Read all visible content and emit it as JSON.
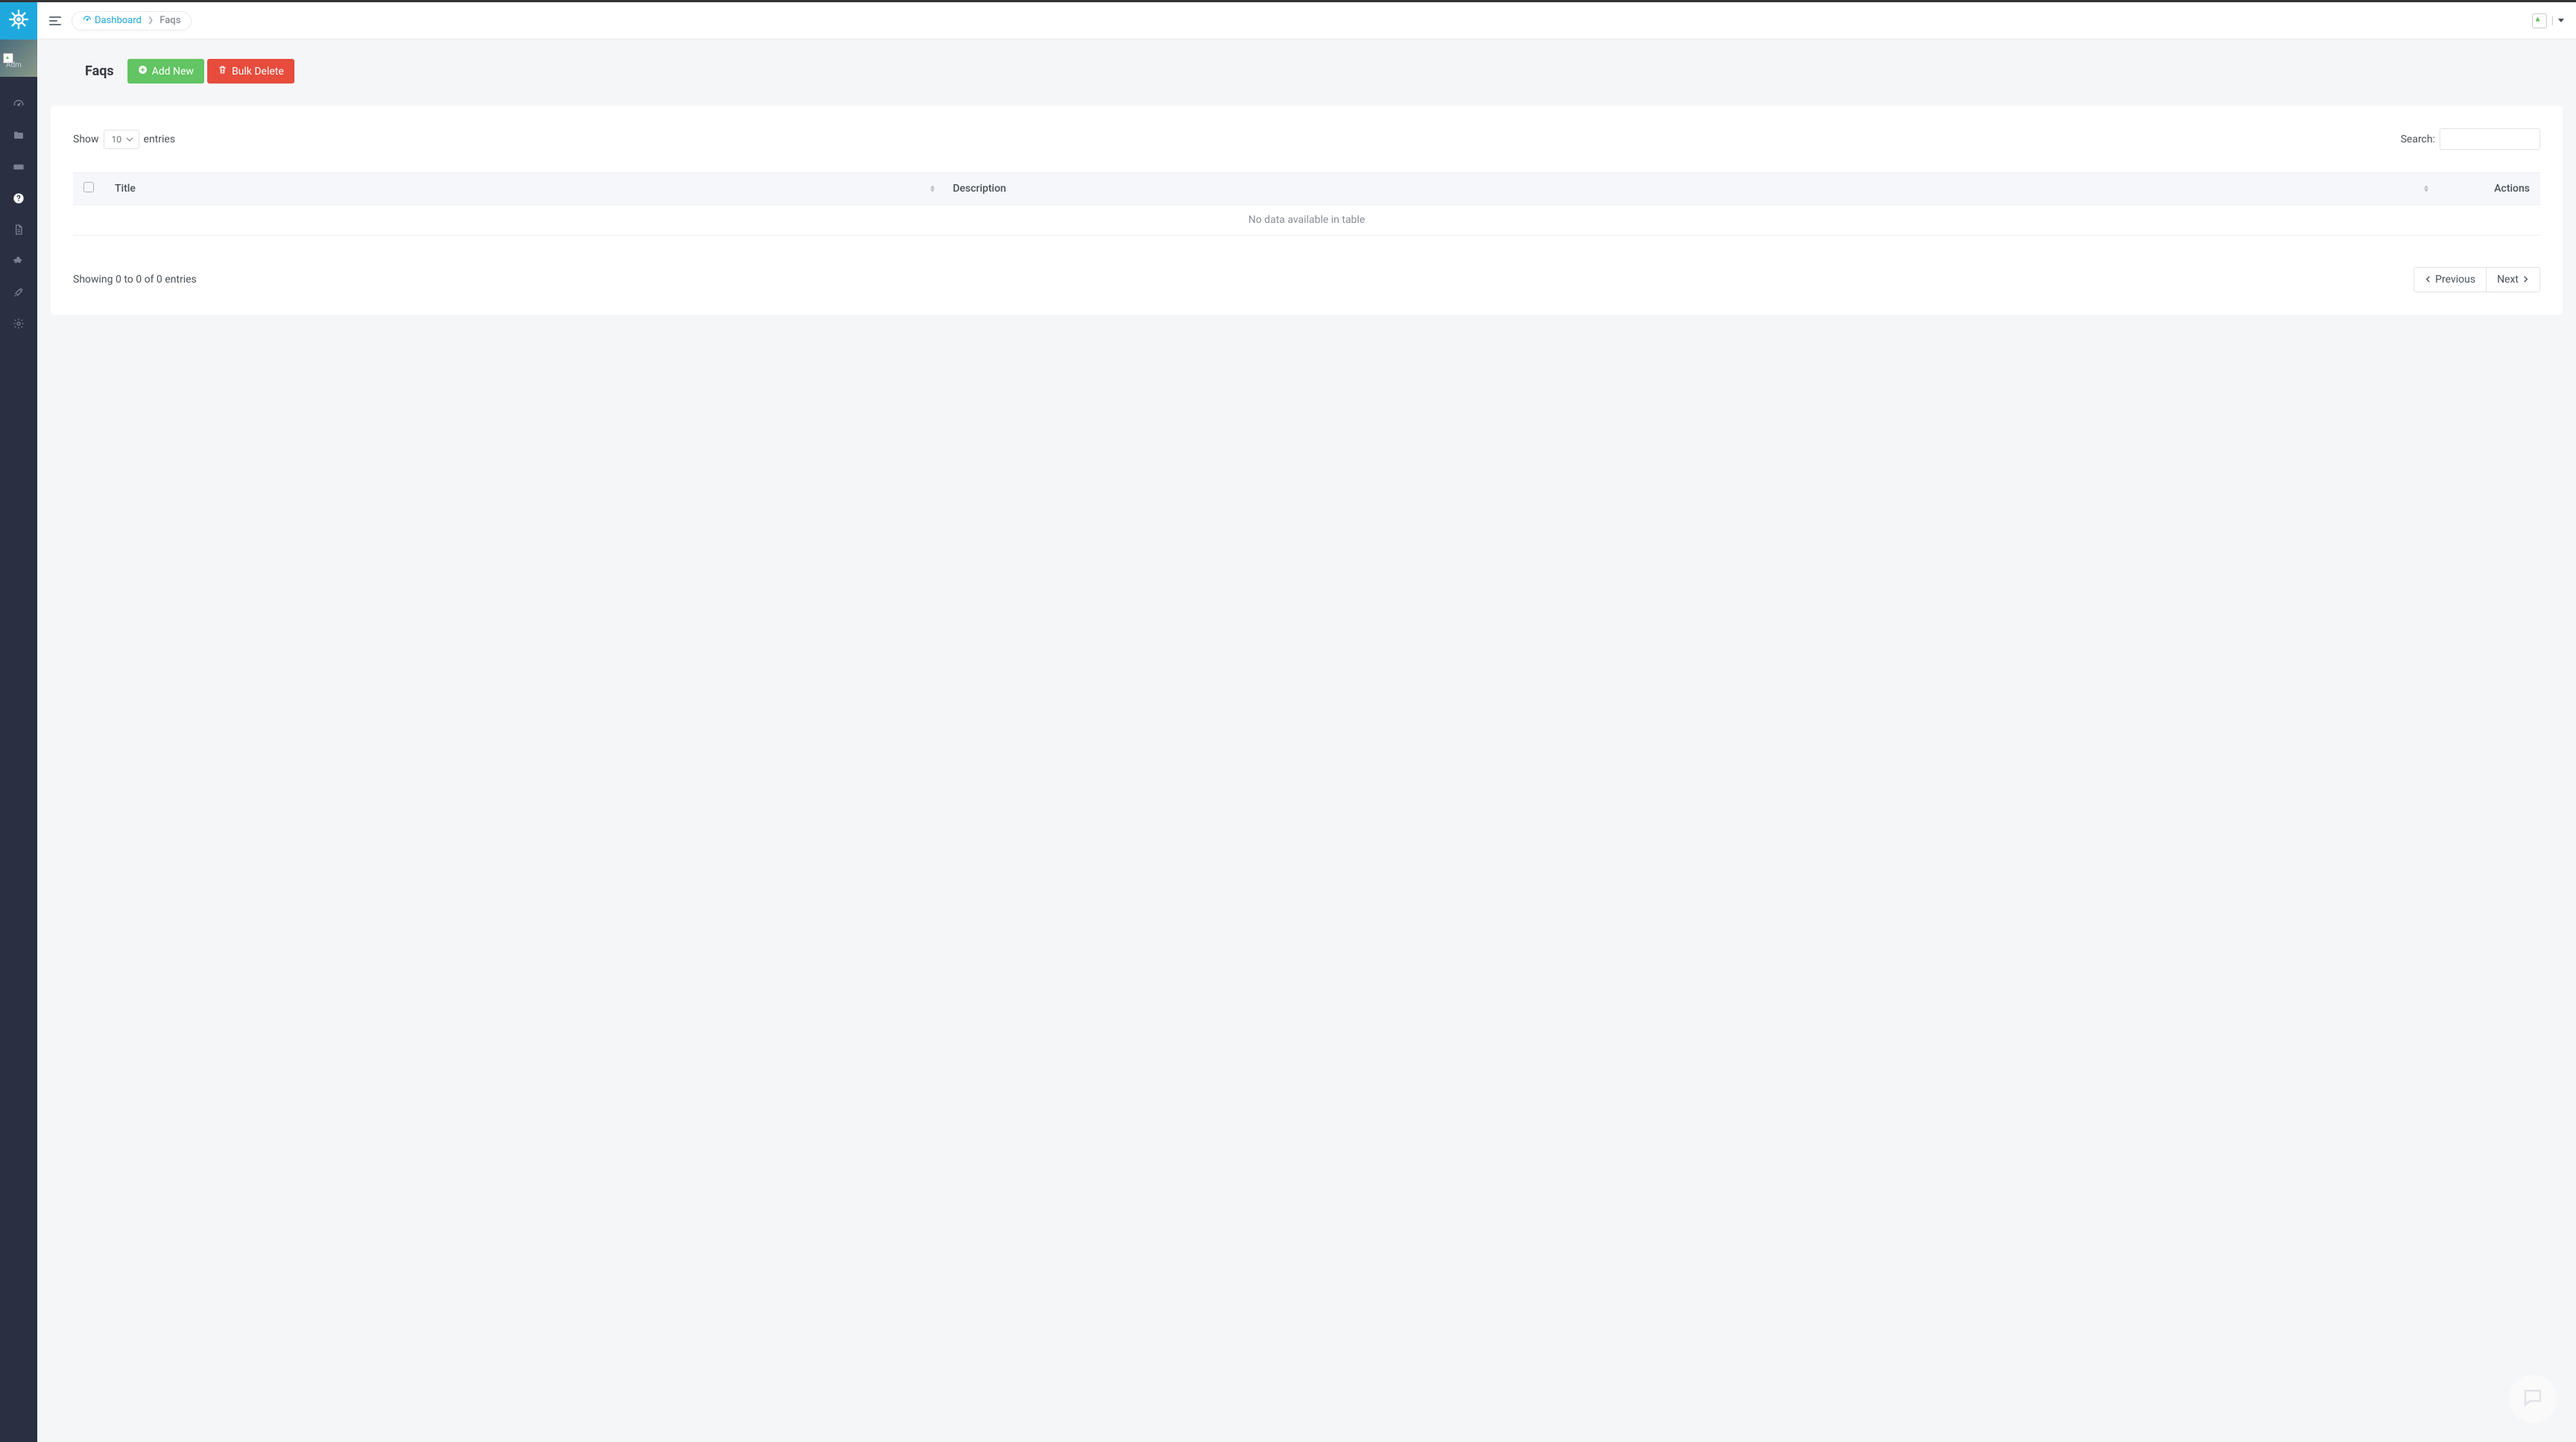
{
  "sidebar": {
    "avatar_label": "Adm"
  },
  "breadcrumb": {
    "dashboard": "Dashboard",
    "current": "Faqs"
  },
  "page": {
    "title": "Faqs"
  },
  "buttons": {
    "add_new": "Add New",
    "bulk_delete": "Bulk Delete"
  },
  "table": {
    "show_label": "Show",
    "entries_label": "entries",
    "length_value": "10",
    "search_label": "Search:",
    "columns": {
      "title": "Title",
      "description": "Description",
      "actions": "Actions"
    },
    "empty_text": "No data available in table",
    "info_text": "Showing 0 to 0 of 0 entries"
  },
  "pager": {
    "previous": "Previous",
    "next": "Next"
  }
}
